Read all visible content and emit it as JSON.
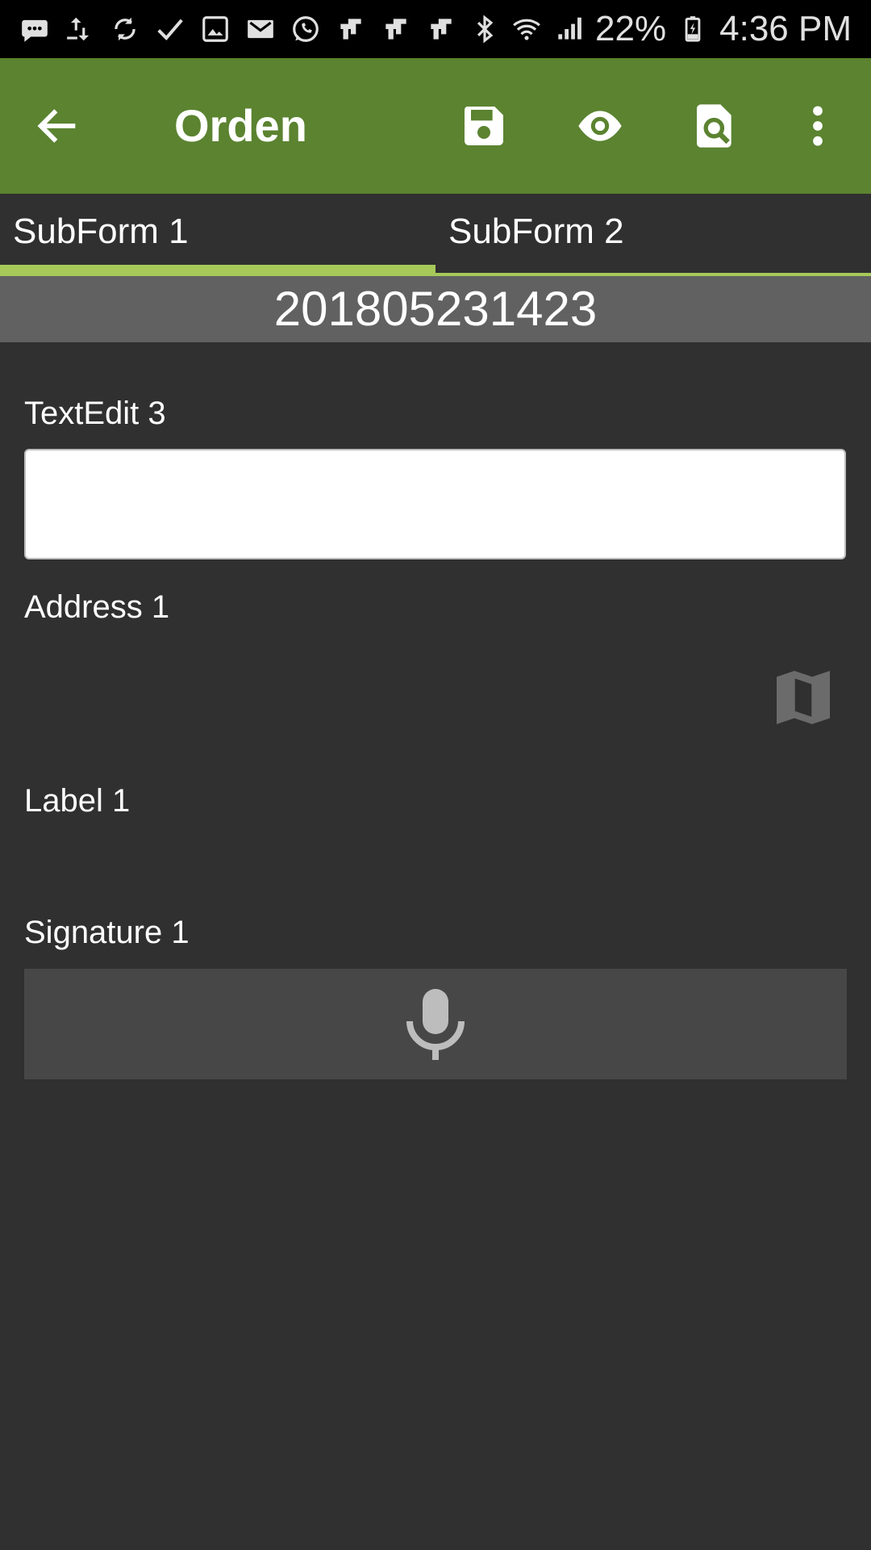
{
  "status_bar": {
    "battery": "22%",
    "time": "4:36 PM",
    "icons": [
      "messages-icon",
      "transfer-icon",
      "sync-icon",
      "check-icon",
      "image-icon",
      "gmail-icon",
      "whatsapp-icon",
      "app-icon",
      "app-icon",
      "app-icon",
      "bluetooth-icon",
      "wifi-icon",
      "signal-icon",
      "battery-icon"
    ]
  },
  "app_bar": {
    "title": "Orden",
    "background": "#5b8330",
    "actions": [
      "save-icon",
      "eye-icon",
      "document-search-icon",
      "more-vert-icon"
    ]
  },
  "tabs": [
    {
      "label": "SubForm 1",
      "active": true
    },
    {
      "label": "SubForm 2",
      "active": false
    }
  ],
  "accent": "#a6c95a",
  "order": {
    "number": "201805231423"
  },
  "form": {
    "textedit_label": "TextEdit 3",
    "textedit_value": "",
    "address_label": "Address 1",
    "label_label": "Label 1",
    "signature_label": "Signature 1"
  }
}
